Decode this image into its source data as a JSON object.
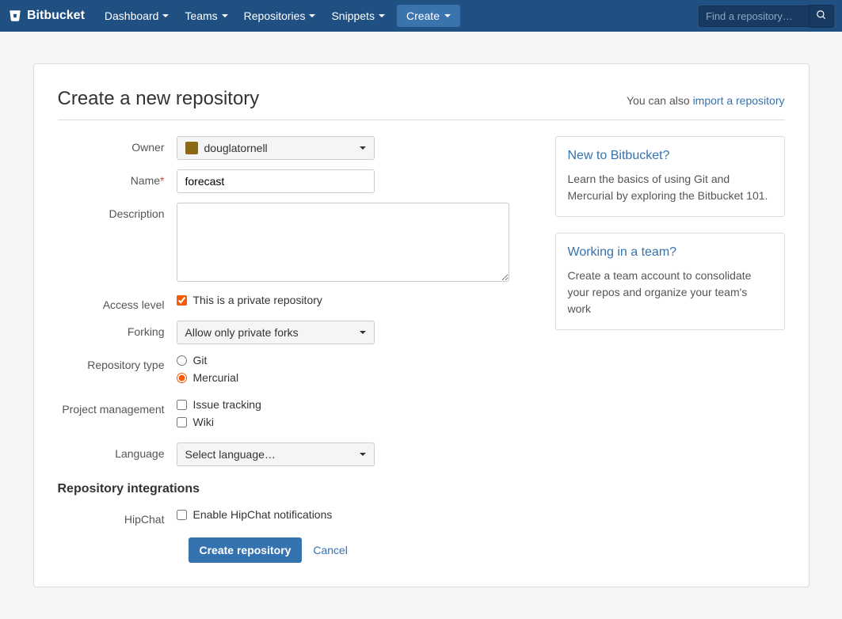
{
  "nav": {
    "brand": "Bitbucket",
    "items": [
      "Dashboard",
      "Teams",
      "Repositories",
      "Snippets"
    ],
    "create": "Create",
    "search_placeholder": "Find a repository…"
  },
  "page": {
    "title": "Create a new repository",
    "import_prefix": "You can also ",
    "import_link": "import a repository"
  },
  "form": {
    "owner_label": "Owner",
    "owner_value": "douglatornell",
    "name_label": "Name",
    "name_value": "forecast",
    "description_label": "Description",
    "access_label": "Access level",
    "access_checkbox": "This is a private repository",
    "forking_label": "Forking",
    "forking_value": "Allow only private forks",
    "repotype_label": "Repository type",
    "repotype_git": "Git",
    "repotype_hg": "Mercurial",
    "pm_label": "Project management",
    "pm_issue": "Issue tracking",
    "pm_wiki": "Wiki",
    "language_label": "Language",
    "language_value": "Select language…",
    "integrations_title": "Repository integrations",
    "hipchat_label": "HipChat",
    "hipchat_checkbox": "Enable HipChat notifications",
    "submit": "Create repository",
    "cancel": "Cancel"
  },
  "sidebar": {
    "box1_title": "New to Bitbucket?",
    "box1_text": "Learn the basics of using Git and Mercurial by exploring the Bitbucket 101.",
    "box2_title": "Working in a team?",
    "box2_text": "Create a team account to consolidate your repos and organize your team's work"
  }
}
